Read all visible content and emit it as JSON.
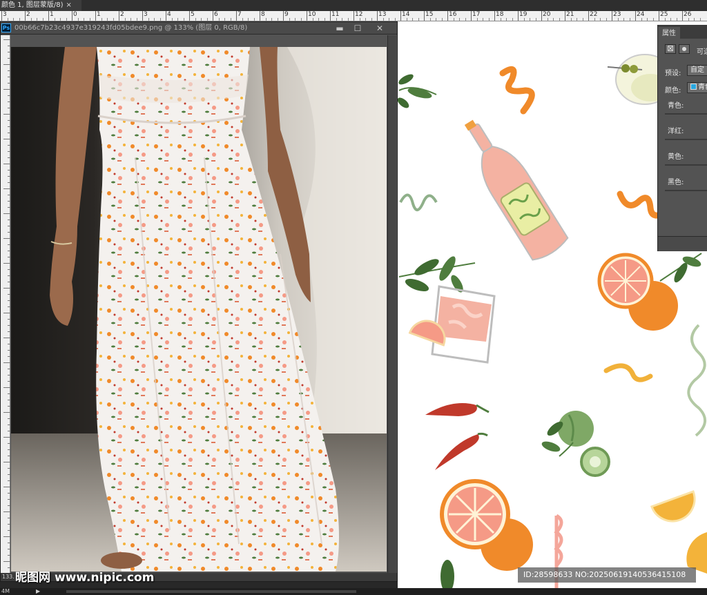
{
  "document_tab": {
    "title": "颜色 1, 图层蒙版/8)",
    "close": "×"
  },
  "ruler": {
    "labels": [
      "3",
      "2",
      "1",
      "0",
      "1",
      "2",
      "3",
      "4",
      "5",
      "6",
      "7",
      "8",
      "9",
      "10",
      "11",
      "12",
      "13",
      "14",
      "15",
      "16",
      "17",
      "18",
      "19",
      "20",
      "21",
      "22",
      "23",
      "24",
      "25",
      "26"
    ]
  },
  "doc_window": {
    "title": "00b66c7b23c4937e319243fd05bdee9.png @ 133% (图层 0, RGB/8)",
    "app_badge": "Ps",
    "minimize": "▬",
    "restore": "☐",
    "close": "✕",
    "status_zoom": "133."
  },
  "properties_panel": {
    "tab": "属性",
    "heading": "可选颜色",
    "preset_label": "预设:",
    "preset_value": "自定",
    "color_label": "颜色:",
    "color_value": "青色",
    "color_swatch": "#29a8e0",
    "sliders": [
      {
        "label": "青色:"
      },
      {
        "label": "洋红:"
      },
      {
        "label": "黄色:"
      },
      {
        "label": "黑色:"
      }
    ]
  },
  "bottom_bar": {
    "zoom": "4M",
    "arrow": "▶"
  },
  "watermark": {
    "logo": "昵图网",
    "site": "www.nipic.com",
    "id_text": "ID:28598633 NO:20250619140536415108"
  },
  "colors": {
    "ps_background": "#282828",
    "panel": "#535353",
    "orange": "#f08a2a",
    "grapefruit": "#f59a86",
    "green_leaf": "#4f7d3e",
    "chili": "#c0392b"
  }
}
